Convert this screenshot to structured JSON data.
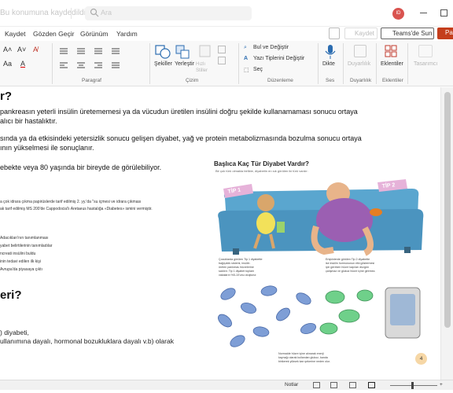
{
  "window": {
    "title": "Bu konumuna kaydedildi",
    "search_placeholder": "Ara",
    "avatar_initials": "ID"
  },
  "menu": {
    "items": [
      "Kaydet",
      "Gözden Geçir",
      "Görünüm",
      "Yardım"
    ],
    "save_label": "Kaydet",
    "teams_label": "Teams'de Sun",
    "share_label": "Pa"
  },
  "ribbon": {
    "paragraph_label": "Paragraf",
    "drawing_label": "Çizim",
    "editing_label": "Düzenleme",
    "voice_label": "Ses",
    "designer_label": "Duyarlılık",
    "addins_label": "Eklentiler",
    "shapes_label": "Şekiller",
    "arrange_label": "Yerleştir",
    "quickstyles_label": "Hızlı Stiller",
    "find_label": "Bul ve Değiştir",
    "replace_fonts_label": "Yazı Tiplerini Değiştir",
    "select_label": "Seç",
    "dictate_label": "Dikte",
    "sensitivity_label": "Duyarlılık",
    "addins_button": "Eklentiler",
    "designer_button": "Tasarımcı"
  },
  "document": {
    "heading1": "r?",
    "p1_line1": "pankreasın yeterli insülin üretememesi ya da vücudun üretilen insülini doğru şekilde kullanamaması sonucu ortaya",
    "p1_line2": "alıcı bir hastalıktır.",
    "p2_line1": "sında ya da etkisindeki yetersizlik sonucu gelişen diyabet, yağ ve protein metabolizmasında bozulma sonucu ortaya",
    "p2_line2": "ının yükselmesi ile sonuçlanır.",
    "p3": "ebekte veya 80 yaşında bir bireyde de görülebiliyor.",
    "history_line1": "a çok idrara çıkma papirüslerde tarif edilmiş 2. yy.'da \"su içmesi ve idrara çıkması",
    "history_line2": "ak tarif edilmiş MS 200'de Cappodocia'lı Aretaeus hastalığa «Diabetes» ismini vermiştir.",
    "timeline": [
      "Adacıkları'nın tanımlanması",
      "yabet belirtilerinin tanımladılar",
      "ncreati insülini buldu",
      "inin tedavi edilen ilk kişi",
      "Avrupa'da piyasaya çıktı"
    ],
    "heading2": "eri?",
    "list_line1": ") diyabeti,",
    "list_line2": "ullanımına dayalı, hormonal bozukluklara dayalı v.b) olarak"
  },
  "figure": {
    "title": "Başlıca Kaç Tür Diyabet Vardır?",
    "subtitle": "Bir çok türü olmakla birlikte, diyabetin en sık görülen iki türü vardır:",
    "tip1_label": "TİP 1",
    "tip2_label": "TİP 2",
    "cap_left": [
      "Çocuklarda görülen Tip 1 diyabette",
      "bağışıklık sistemi, insülin",
      "üreten pankreas hücrelerine",
      "saldırır. Tip 1 diyabet toplam",
      "vakaların %5-10'unu oluşturur."
    ],
    "cap_right": [
      "Erişkinlerde görülen Tip 2 diyabette",
      "ise insülin hormonunun etki göstermesi",
      "için gereken hücre kapıları düzgün",
      "çalışmaz ve glukoz hücre içine giremez."
    ],
    "cap_bottom": [
      "Normalde hücre içine alınarak enerji",
      "kaynağı olarak kullanılan glukoz, kanda",
      "birikerek yüksek kan şekerine neden olur."
    ],
    "page_number": "4"
  },
  "status": {
    "notes_label": "Notlar"
  },
  "colors": {
    "share_button": "#c43e1c",
    "avatar": "#d9534f",
    "couch": "#5aa6cf",
    "tip_banner": "#e6b2d9"
  }
}
